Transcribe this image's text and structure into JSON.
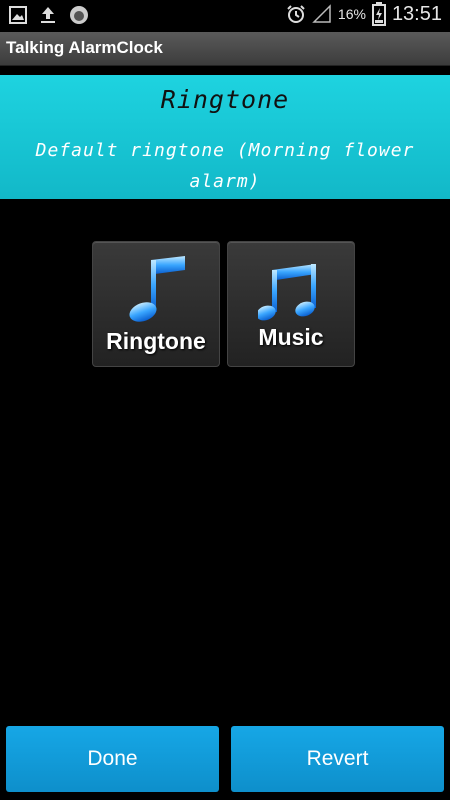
{
  "status_bar": {
    "battery_percent": "16%",
    "time": "13:51",
    "icons": [
      "gallery-icon",
      "upload-icon",
      "app-icon",
      "alarm-icon",
      "signal-icon",
      "battery-icon"
    ]
  },
  "app": {
    "title": "Talking AlarmClock"
  },
  "header": {
    "title": "Ringtone",
    "subtitle": "Default ringtone (Morning flower alarm)"
  },
  "options": [
    {
      "label": "Ringtone",
      "icon": "music-note-icon"
    },
    {
      "label": "Music",
      "icon": "music-note-icon"
    }
  ],
  "buttons": {
    "done": "Done",
    "revert": "Revert"
  },
  "colors": {
    "header_bg": "#1ed3e0",
    "button_bg": "#16a7e6",
    "tile_bg": "#2e2e2e"
  }
}
